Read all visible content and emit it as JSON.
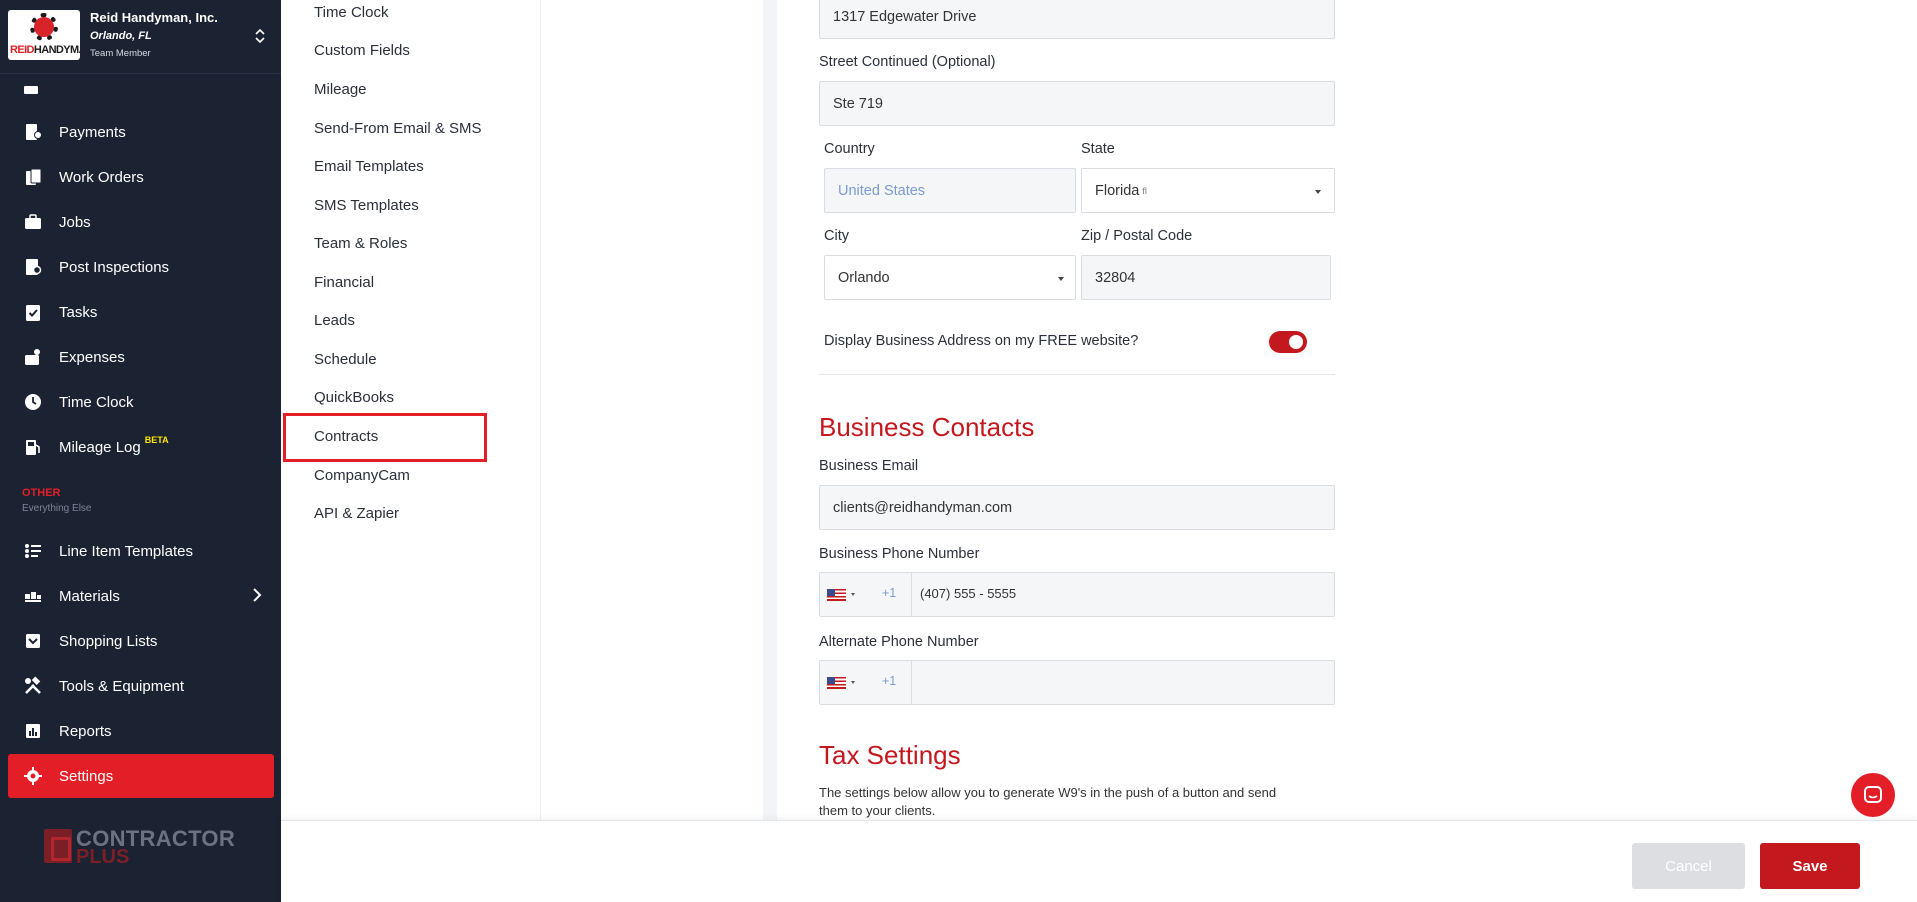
{
  "company": {
    "name": "Reid Handyman, Inc.",
    "location": "Orlando, FL",
    "role": "Team Member",
    "logo_word_red": "REID",
    "logo_word_dark": "HANDYMAN"
  },
  "nav": {
    "items": [
      {
        "label": "Payments",
        "icon": "payments-icon"
      },
      {
        "label": "Work Orders",
        "icon": "work-orders-icon"
      },
      {
        "label": "Jobs",
        "icon": "briefcase-icon"
      },
      {
        "label": "Post Inspections",
        "icon": "inspection-icon"
      },
      {
        "label": "Tasks",
        "icon": "clipboard-check-icon"
      },
      {
        "label": "Expenses",
        "icon": "expenses-icon"
      },
      {
        "label": "Time Clock",
        "icon": "clock-icon"
      },
      {
        "label": "Mileage Log",
        "icon": "fuel-icon",
        "badge": "BETA"
      },
      {
        "label": "Line Item Templates",
        "icon": "list-icon"
      },
      {
        "label": "Materials",
        "icon": "materials-icon"
      },
      {
        "label": "Shopping Lists",
        "icon": "cart-icon"
      },
      {
        "label": "Tools & Equipment",
        "icon": "tools-icon"
      },
      {
        "label": "Reports",
        "icon": "chart-icon"
      },
      {
        "label": "Settings",
        "icon": "gear-icon"
      }
    ],
    "other_title": "OTHER",
    "other_subtitle": "Everything Else",
    "active": "Settings"
  },
  "brand": {
    "line1": "CONTRACTOR",
    "line2": "PLUS"
  },
  "submenu": {
    "items": [
      "Time Clock",
      "Custom Fields",
      "Mileage",
      "Send-From Email & SMS",
      "Email Templates",
      "SMS Templates",
      "Team & Roles",
      "Financial",
      "Leads",
      "Schedule",
      "QuickBooks",
      "Contracts",
      "CompanyCam",
      "API & Zapier"
    ],
    "highlighted": "Contracts"
  },
  "form": {
    "street_value": "1317 Edgewater Drive",
    "street2_label": "Street Continued (Optional)",
    "street2_value": "Ste 719",
    "country_label": "Country",
    "country_placeholder": "United States",
    "state_label": "State",
    "state_value": "Florida",
    "state_suffix": "fl",
    "city_label": "City",
    "city_value": "Orlando",
    "zip_label": "Zip / Postal Code",
    "zip_value": "32804",
    "display_address_label": "Display Business Address on my FREE website?",
    "display_address_on": true,
    "contacts_title": "Business Contacts",
    "email_label": "Business Email",
    "email_value": "clients@reidhandyman.com",
    "phone_label": "Business Phone Number",
    "phone_code": "+1",
    "phone_value": "(407) 555 - 5555",
    "alt_phone_label": "Alternate Phone Number",
    "alt_phone_code": "+1",
    "alt_phone_value": "",
    "tax_title": "Tax Settings",
    "tax_desc_line1": "The settings below allow you to generate W9's in the push of a button and send",
    "tax_desc_line2": "them to your clients."
  },
  "footer": {
    "cancel_label": "Cancel",
    "save_label": "Save"
  },
  "colors": {
    "sidebar_bg": "#1b2333",
    "accent_red": "#e41e26",
    "title_red": "#c4181f"
  }
}
